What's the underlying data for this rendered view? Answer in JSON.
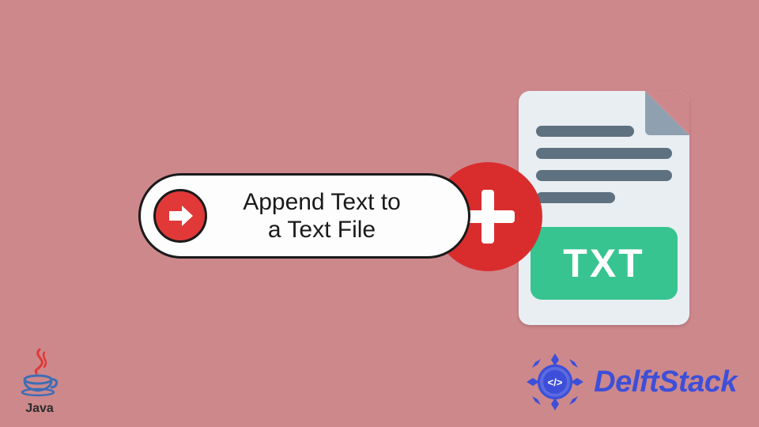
{
  "banner": {
    "title_line1": "Append Text to",
    "title_line2": "a Text File"
  },
  "file": {
    "badge": "TXT"
  },
  "java": {
    "label": "Java"
  },
  "brand": {
    "name": "DelftStack",
    "code_symbol": "</>"
  },
  "colors": {
    "background": "#cd888c",
    "accent_red": "#d92d2d",
    "file_bg": "#e9eef2",
    "file_line": "#5e7181",
    "txt_badge": "#37c490",
    "brand_blue": "#3d4fd8"
  }
}
